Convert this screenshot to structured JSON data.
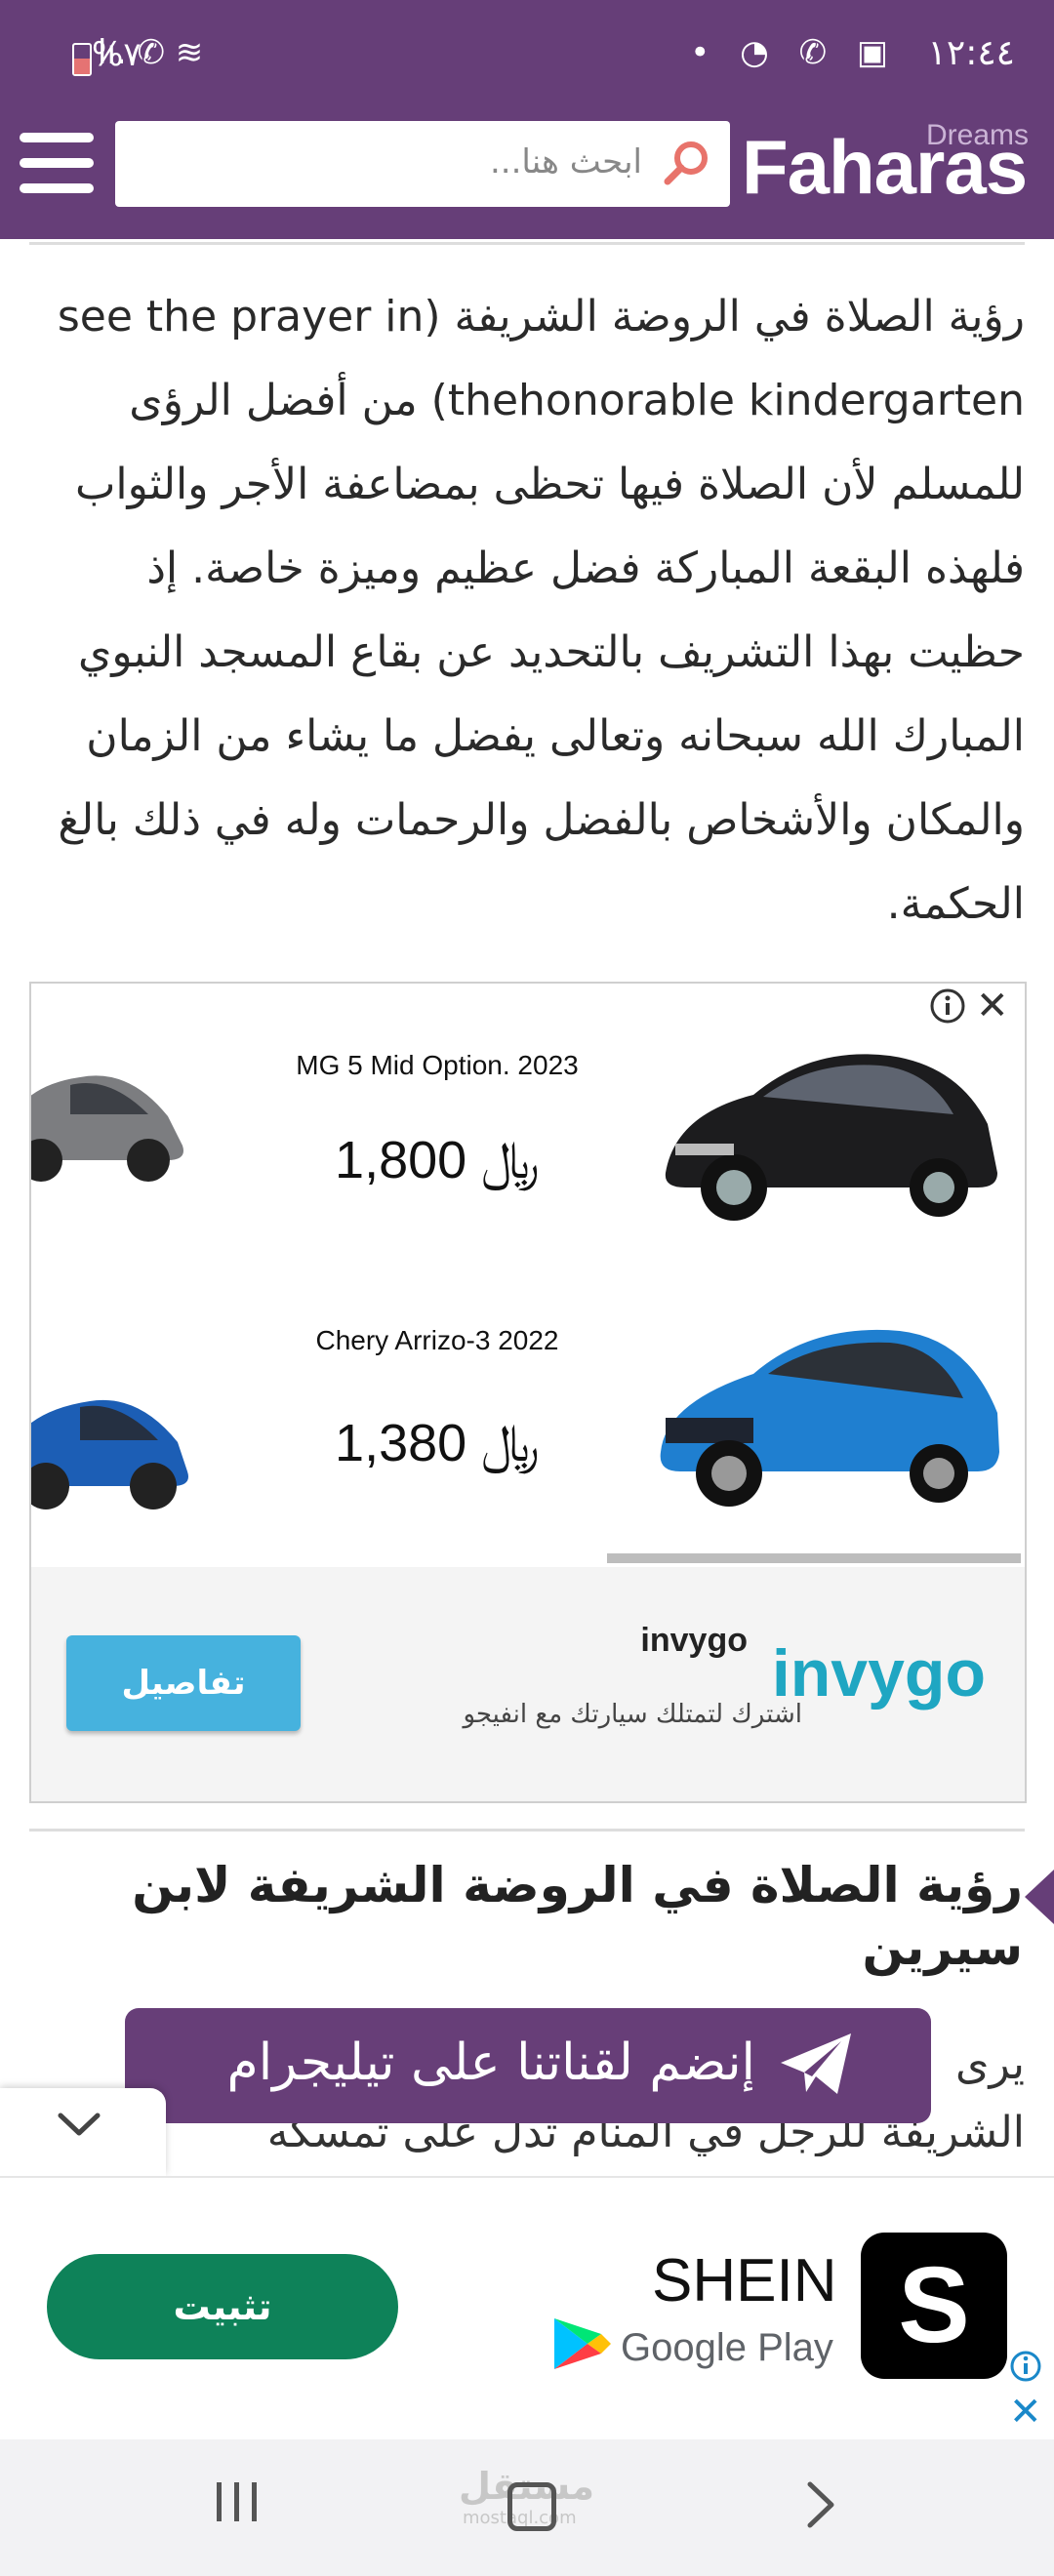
{
  "status_bar": {
    "time": "١٢:٤٤",
    "notif_icons": "• ◔ ✆ ▣",
    "battery": "%٧",
    "network": "lı. ✆ ≋"
  },
  "header": {
    "logo_word": "Faharas",
    "logo_tag": "Dreams",
    "search_placeholder": "ابحث هنا...",
    "colors": {
      "brand": "#663e78"
    }
  },
  "article": {
    "paragraph": "رؤية الصلاة في الروضة الشريفة (see the prayer in thehonorable kindergarten) من أفضل الرؤى للمسلم لأن الصلاة فيها تحظى بمضاعفة الأجر والثواب فلهذه البقعة المباركة فضل عظيم وميزة خاصة. إذ حظيت بهذا التشريف بالتحديد عن بقاع المسجد النبوي المبارك الله سبحانه وتعالى يفضل ما يشاء من الزمان والمكان والأشخاص بالفضل والرحمات وله في ذلك بالغ الحكمة.",
    "heading": "رؤية الصلاة في الروضة الشريفة لابن سيرين",
    "para2_start": "يرى",
    "para2_line2": "الشريفة للرجل في المنام تدل على تمسكه"
  },
  "car_ad": {
    "offers": [
      {
        "name": "MG 5 Mid Option. 2023",
        "price": "1,800 ﷼"
      },
      {
        "name": "Chery Arrizo-3 2022",
        "price": "1,380 ﷼"
      }
    ],
    "brand": "invygo",
    "tagline": "اشترك لتمتلك سيارتك مع انفيجو",
    "button_label": "تفاصيل",
    "logo_text": "invygo",
    "close": "✕"
  },
  "telegram_banner": {
    "label": "إنضم لقناتنا على تيليجرام"
  },
  "app_ad": {
    "app_name": "SHEIN",
    "store": "Google Play",
    "install_label": "تثبيت",
    "icon_letter": "S",
    "close": "✕"
  },
  "nav": {
    "watermark": "مستقل",
    "watermark_sub": "mostaql.com"
  }
}
